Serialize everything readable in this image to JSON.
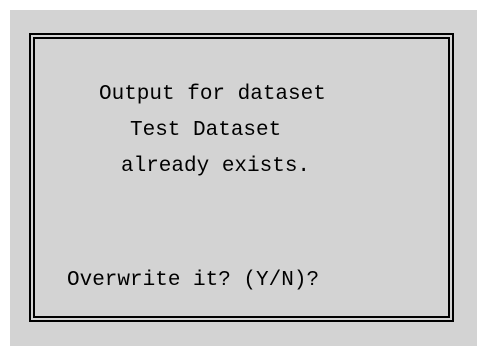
{
  "dialog": {
    "message_lines": [
      "Output for dataset",
      "Test Dataset",
      "already exists."
    ],
    "prompt": "Overwrite it? (Y/N)?"
  },
  "colors": {
    "background": "#d3d3d3",
    "border": "#000000",
    "text": "#000000"
  }
}
